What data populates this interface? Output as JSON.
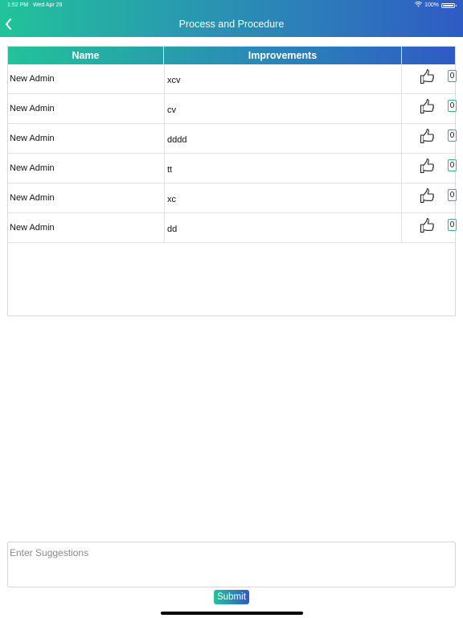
{
  "status_bar": {
    "time": "1:52 PM",
    "date": "Wed Apr 29",
    "battery": "100%"
  },
  "nav": {
    "title": "Process and Procedure",
    "back_icon": "chevron-left-icon"
  },
  "table": {
    "columns": [
      "Name",
      "Improvements",
      ""
    ],
    "rows": [
      {
        "name": "New Admin",
        "improvement": "xcv",
        "likes": "0"
      },
      {
        "name": "New Admin",
        "improvement": "cv",
        "likes": "0"
      },
      {
        "name": "New Admin",
        "improvement": "dddd",
        "likes": "0"
      },
      {
        "name": "New Admin",
        "improvement": "tt",
        "likes": "0"
      },
      {
        "name": "New Admin",
        "improvement": "xc",
        "likes": "0"
      },
      {
        "name": "New Admin",
        "improvement": "dd",
        "likes": "0"
      }
    ],
    "like_icon": "thumbs-up-icon"
  },
  "suggestions": {
    "placeholder": "Enter Suggestions",
    "value": ""
  },
  "submit_label": "Submit",
  "colors": {
    "gradient_start": "#22c39a",
    "gradient_end": "#2f5bc4",
    "like_border": "#2bb39a"
  }
}
